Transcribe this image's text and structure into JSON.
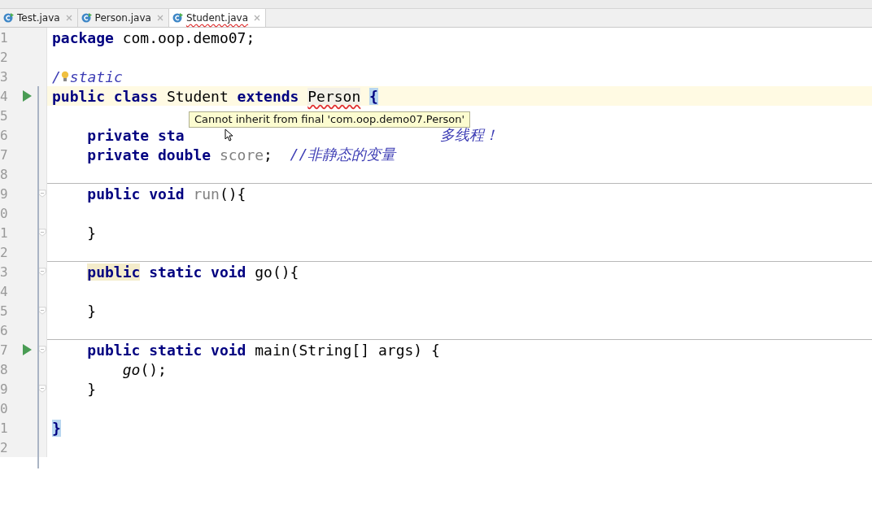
{
  "tabs": [
    {
      "label": "Test.java",
      "selected": false,
      "error": false
    },
    {
      "label": "Person.java",
      "selected": false,
      "error": false
    },
    {
      "label": "Student.java",
      "selected": true,
      "error": true
    }
  ],
  "editor": {
    "lines": [
      {
        "number": "1",
        "tokens": [
          {
            "text": "package ",
            "kind": "keyword"
          },
          {
            "text": "com.oop.demo07;",
            "kind": "plain"
          }
        ]
      },
      {
        "number": "2"
      },
      {
        "number": "3",
        "bulb": true,
        "tokens": [
          {
            "text": "/",
            "kind": "comment"
          },
          {
            "text": "static",
            "kind": "comment"
          }
        ]
      },
      {
        "number": "4",
        "current": true,
        "run": true,
        "tokens": [
          {
            "text": "public ",
            "kind": "keyword"
          },
          {
            "text": "class ",
            "kind": "keyword"
          },
          {
            "text": "Student ",
            "kind": "plain"
          },
          {
            "text": "extends ",
            "kind": "keyword"
          },
          {
            "text": "Person",
            "kind": "error"
          },
          {
            "text": " {",
            "kind": "brace"
          }
        ]
      },
      {
        "number": "5"
      },
      {
        "number": "6",
        "tokens": [
          {
            "text": "    private ",
            "kind": "keyword"
          },
          {
            "text": "sta",
            "kind": "keyword"
          },
          {
            "text": "                             多线程！",
            "kind": "comment"
          }
        ]
      },
      {
        "number": "7",
        "tokens": [
          {
            "text": "    private ",
            "kind": "keyword"
          },
          {
            "text": "double ",
            "kind": "keyword"
          },
          {
            "text": "score",
            "kind": "unused"
          },
          {
            "text": ";  ",
            "kind": "plain"
          },
          {
            "text": "//非静态的变量",
            "kind": "comment"
          }
        ]
      },
      {
        "number": "8",
        "separator": true
      },
      {
        "number": "9",
        "fold": true,
        "tokens": [
          {
            "text": "    public ",
            "kind": "keyword"
          },
          {
            "text": "void ",
            "kind": "keyword"
          },
          {
            "text": "run",
            "kind": "unused"
          },
          {
            "text": "(){",
            "kind": "plain"
          }
        ]
      },
      {
        "number": "0"
      },
      {
        "number": "1",
        "fold": true,
        "tokens": [
          {
            "text": "    }",
            "kind": "plain"
          }
        ]
      },
      {
        "number": "2",
        "separator": true
      },
      {
        "number": "3",
        "fold": true,
        "tokens": [
          {
            "text": "    public",
            "kind": "usage"
          },
          {
            "text": " static ",
            "kind": "keyword"
          },
          {
            "text": "void ",
            "kind": "keyword"
          },
          {
            "text": "go(){",
            "kind": "plain"
          }
        ]
      },
      {
        "number": "4"
      },
      {
        "number": "5",
        "fold": true,
        "tokens": [
          {
            "text": "    }",
            "kind": "plain"
          }
        ]
      },
      {
        "number": "6",
        "separator": true
      },
      {
        "number": "7",
        "run": true,
        "fold": true,
        "tokens": [
          {
            "text": "    public ",
            "kind": "keyword"
          },
          {
            "text": "static ",
            "kind": "keyword"
          },
          {
            "text": "void ",
            "kind": "keyword"
          },
          {
            "text": "main(String[] args) {",
            "kind": "plain"
          }
        ]
      },
      {
        "number": "8",
        "tokens": [
          {
            "text": "        go",
            "kind": "static-call"
          },
          {
            "text": "();",
            "kind": "plain"
          }
        ]
      },
      {
        "number": "9",
        "fold": true,
        "tokens": [
          {
            "text": "    }",
            "kind": "plain"
          }
        ]
      },
      {
        "number": "0"
      },
      {
        "number": "1",
        "tokens": [
          {
            "text": "}",
            "kind": "brace"
          }
        ]
      },
      {
        "number": "2"
      }
    ],
    "tooltip": {
      "text": "Cannot inherit from final 'com.oop.demo07.Person'"
    }
  }
}
